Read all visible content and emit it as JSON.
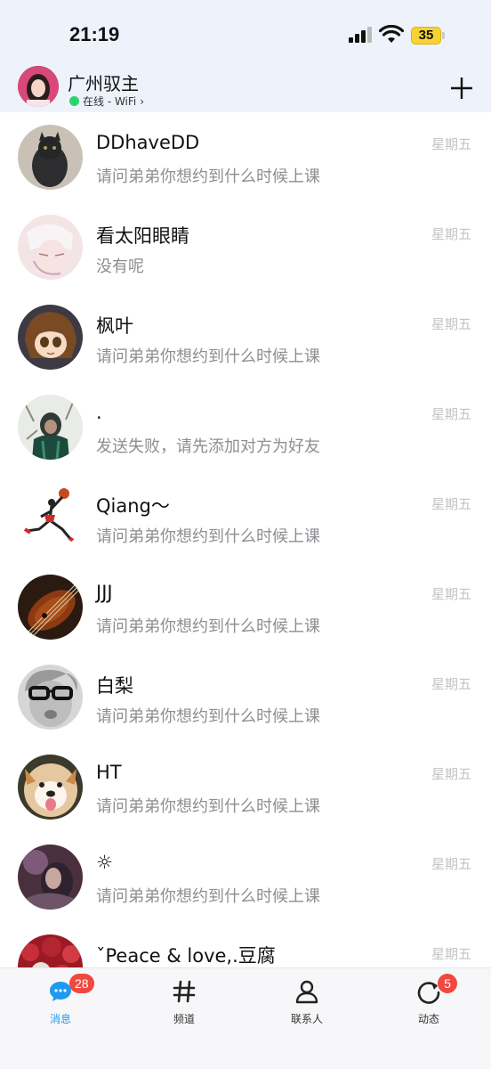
{
  "status_bar": {
    "time": "21:19",
    "battery": "35",
    "battery_color": "#f7d233"
  },
  "header": {
    "username": "广州驭主",
    "status": "在线 - WiFi",
    "status_chevron": "›",
    "status_color": "#2dd36f",
    "add_icon": "plus-icon"
  },
  "conversations": [
    {
      "name": "DDhaveDD",
      "preview": "请问弟弟你想约到什么时候上课",
      "time": "星期五"
    },
    {
      "name": "看太阳眼睛",
      "preview": "没有呢",
      "time": "星期五"
    },
    {
      "name": "枫叶",
      "preview": "请问弟弟你想约到什么时候上课",
      "time": "星期五"
    },
    {
      "name": ".",
      "preview": "发送失败，请先添加对方为好友",
      "time": "星期五"
    },
    {
      "name": "Qiang～",
      "preview": "请问弟弟你想约到什么时候上课",
      "time": "星期五"
    },
    {
      "name": "JJJ",
      "preview": "请问弟弟你想约到什么时候上课",
      "time": "星期五"
    },
    {
      "name": "白梨",
      "preview": "请问弟弟你想约到什么时候上课",
      "time": "星期五"
    },
    {
      "name": "HT",
      "preview": "请问弟弟你想约到什么时候上课",
      "time": "星期五"
    },
    {
      "name": "☼",
      "preview": "请问弟弟你想约到什么时候上课",
      "time": "星期五"
    },
    {
      "name": "ˇPeace & love,.豆腐",
      "preview": "",
      "time": "星期五"
    }
  ],
  "tabbar": {
    "tabs": [
      {
        "label": "消息",
        "icon": "chat-bubble-icon",
        "badge": "28",
        "active": true
      },
      {
        "label": "频道",
        "icon": "hashtag-icon",
        "badge": "",
        "active": false
      },
      {
        "label": "联系人",
        "icon": "person-icon",
        "badge": "",
        "active": false
      },
      {
        "label": "动态",
        "icon": "refresh-circle-icon",
        "badge": "5",
        "active": false
      }
    ],
    "active_color": "#1d9bf0",
    "badge_color": "#f0483e"
  }
}
